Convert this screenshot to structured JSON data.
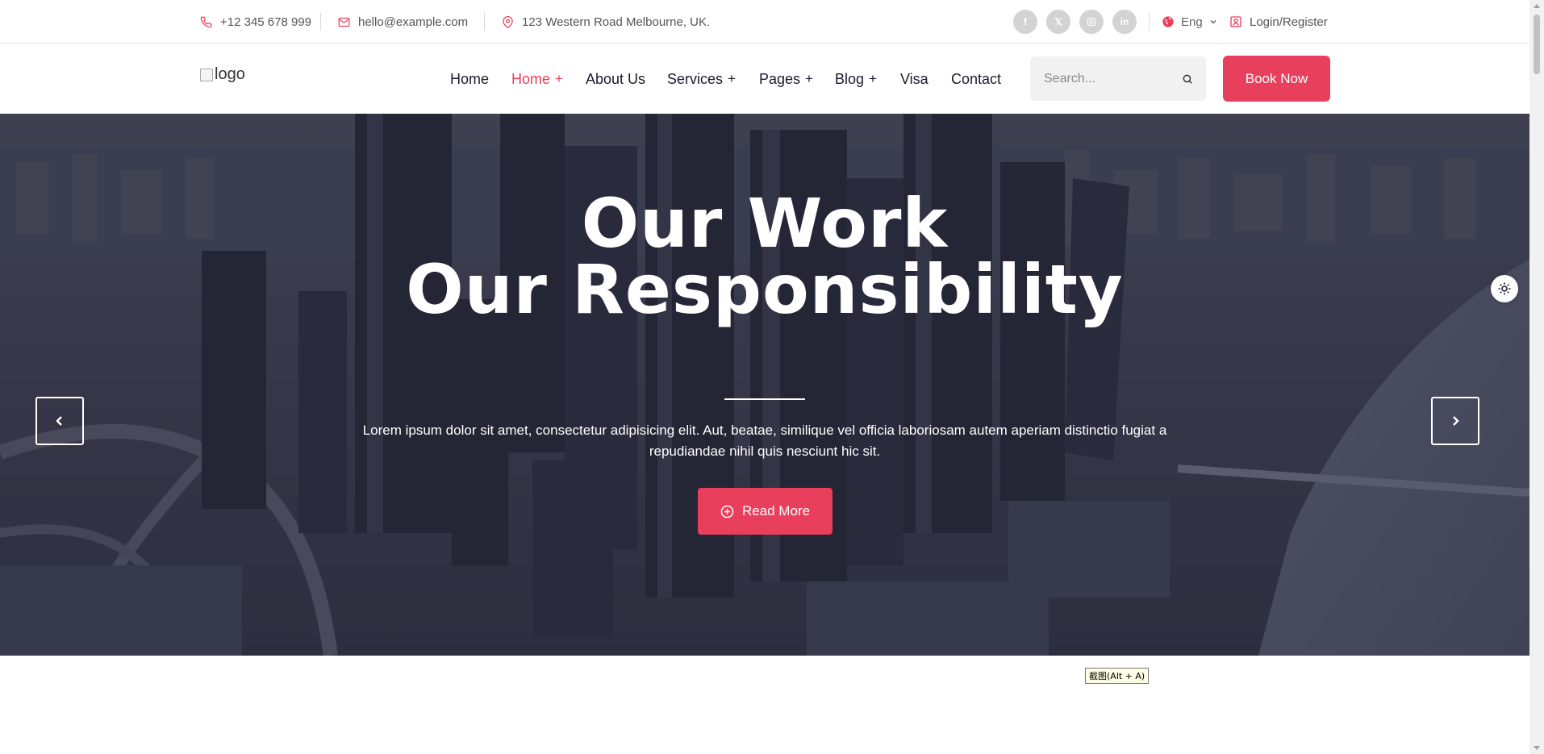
{
  "topbar": {
    "phone": "+12 345 678 999",
    "email": "hello@example.com",
    "address": "123 Western Road Melbourne, UK.",
    "social_icons": [
      "facebook-icon",
      "x-icon",
      "instagram-icon",
      "linkedin-icon"
    ],
    "social_labels": {
      "facebook": "f",
      "x": "𝕏",
      "linkedin": "in"
    },
    "language": "Eng",
    "login_label": "Login/Register"
  },
  "header": {
    "logo_alt": "logo",
    "nav": [
      {
        "label": "Home",
        "has_submenu": false,
        "active": false
      },
      {
        "label": "Home",
        "has_submenu": true,
        "active": true
      },
      {
        "label": "About Us",
        "has_submenu": false,
        "active": false
      },
      {
        "label": "Services",
        "has_submenu": true,
        "active": false
      },
      {
        "label": "Pages",
        "has_submenu": true,
        "active": false
      },
      {
        "label": "Blog",
        "has_submenu": true,
        "active": false
      },
      {
        "label": "Visa",
        "has_submenu": false,
        "active": false
      },
      {
        "label": "Contact",
        "has_submenu": false,
        "active": false
      }
    ],
    "submenu_marker": "+",
    "search_placeholder": "Search...",
    "book_label": "Book Now"
  },
  "hero": {
    "title_line1": "Our Work",
    "title_line2": "Our Responsibility",
    "description": "Lorem ipsum dolor sit amet, consectetur adipisicing elit. Aut, beatae, similique vel officia laboriosam autem aperiam distinctio fugiat a repudiandae nihil quis nesciunt hic sit.",
    "read_more_label": "Read More"
  },
  "tooltip": "截图(Alt + A)",
  "colors": {
    "accent": "#e8405c",
    "nav_text": "#1a1a2e",
    "hero_overlay": "#1c1e34"
  }
}
